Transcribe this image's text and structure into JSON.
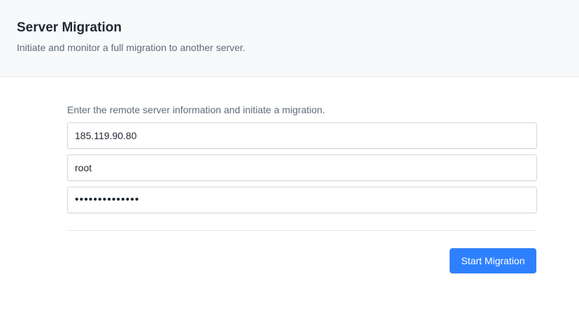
{
  "header": {
    "title": "Server Migration",
    "subtitle": "Initiate and monitor a full migration to another server."
  },
  "form": {
    "instructions": "Enter the remote server information and initiate a migration.",
    "host_value": "185.119.90.80",
    "username_value": "root",
    "password_value": "••••••••••••••"
  },
  "actions": {
    "start_label": "Start Migration"
  },
  "colors": {
    "header_background": "#f8f9fb",
    "primary_button": "#2f80ff",
    "title_text": "#1f2933",
    "muted_text": "#5f6b7a"
  }
}
